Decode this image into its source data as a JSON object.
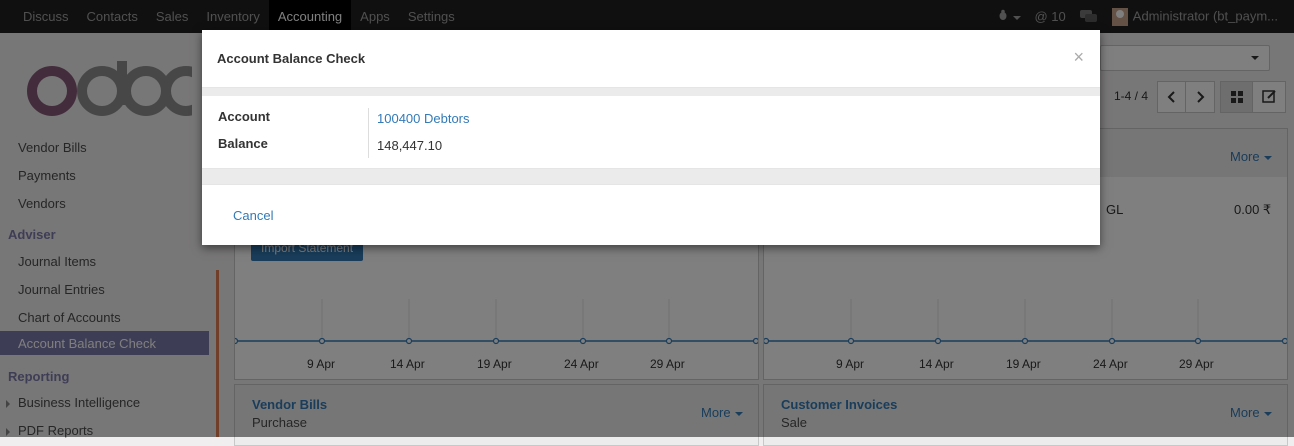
{
  "topbar": {
    "menu": [
      "Discuss",
      "Contacts",
      "Sales",
      "Inventory",
      "Accounting",
      "Apps",
      "Settings"
    ],
    "active": "Accounting",
    "mentions": "@ 10",
    "user": "Administrator (bt_paym..."
  },
  "sidebar": {
    "items_top": [
      "Vendor Bills",
      "Payments",
      "Vendors"
    ],
    "adviser_head": "Adviser",
    "adviser_items": [
      "Journal Items",
      "Journal Entries",
      "Chart of Accounts"
    ],
    "active_item": "Account Balance Check",
    "reporting_head": "Reporting",
    "reporting_items": [
      "Business Intelligence",
      "PDF Reports"
    ]
  },
  "content": {
    "pager": "1-4 / 4",
    "more_label": "More",
    "gl_label": "GL",
    "gl_value": "0.00 ₹",
    "import_button": "Import Statement",
    "axis_ticks": [
      "9 Apr",
      "14 Apr",
      "19 Apr",
      "24 Apr",
      "29 Apr"
    ],
    "card_bottom_left_title": "Vendor Bills",
    "card_bottom_left_sub": "Purchase",
    "card_bottom_right_title": "Customer Invoices",
    "card_bottom_right_sub": "Sale"
  },
  "dialog": {
    "title": "Account Balance Check",
    "close": "×",
    "account_label": "Account",
    "account_value": "100400 Debtors",
    "balance_label": "Balance",
    "balance_value": "148,447.10",
    "cancel_label": "Cancel"
  },
  "colors": {
    "topbar": "#212121",
    "accent": "#7c7bad",
    "link": "#337ab7"
  }
}
